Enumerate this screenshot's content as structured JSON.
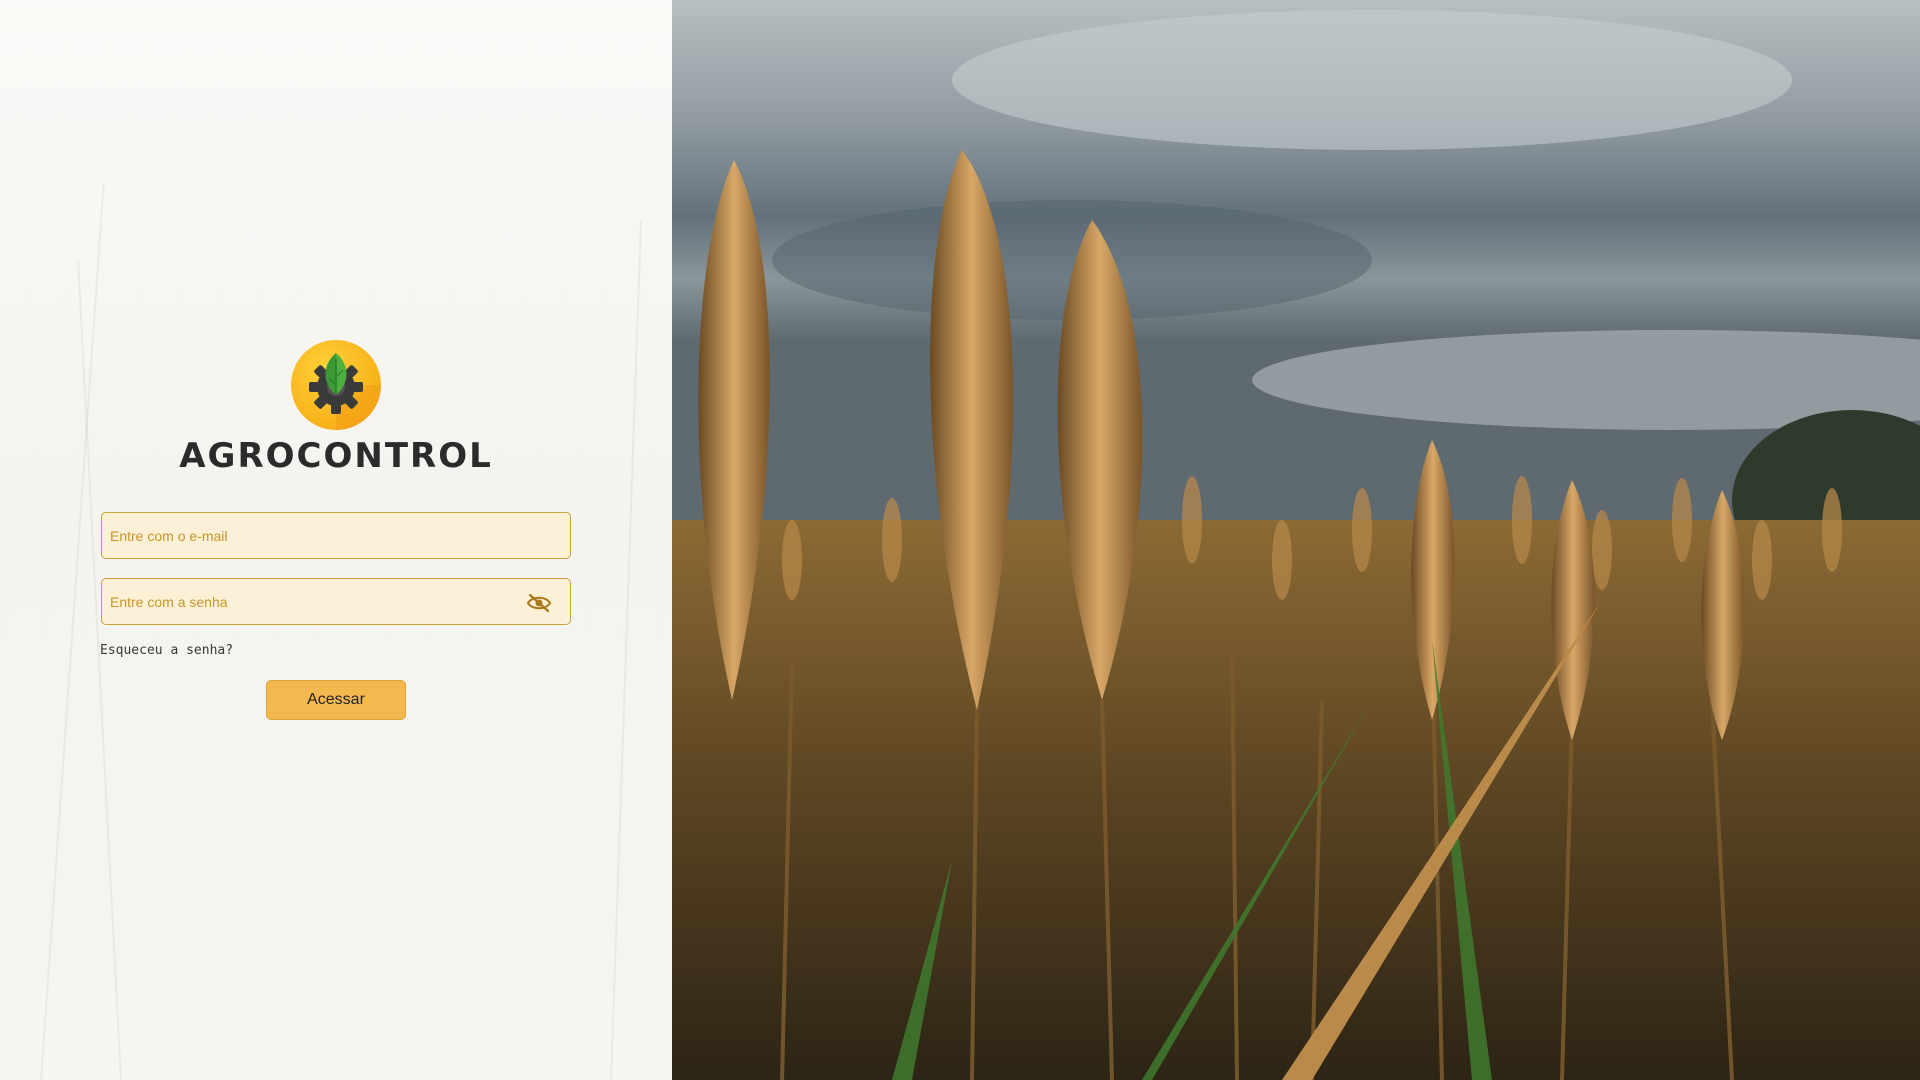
{
  "brand": {
    "name": "AGROCONTROL",
    "logo_icon": "leaf-gear-icon"
  },
  "login": {
    "email_placeholder": "Entre com o e-mail",
    "password_placeholder": "Entre com a senha",
    "toggle_password_icon": "eye-slash-icon",
    "forgot_password_label": "Esqueceu a senha?",
    "submit_label": "Acessar"
  },
  "background_image": {
    "description": "wheat-field-photo"
  },
  "colors": {
    "accent": "#f5b750",
    "input_border": "#c8a23c",
    "input_background": "#fcf0d6",
    "brand_text": "#2b2b2b"
  }
}
